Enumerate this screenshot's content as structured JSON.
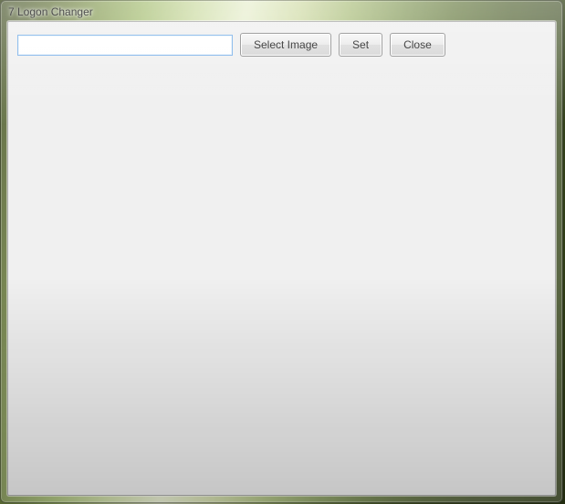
{
  "window": {
    "title": "7 Logon Changer"
  },
  "toolbar": {
    "path_value": "",
    "path_placeholder": "",
    "select_image_label": "Select Image",
    "set_label": "Set",
    "close_label": "Close"
  }
}
